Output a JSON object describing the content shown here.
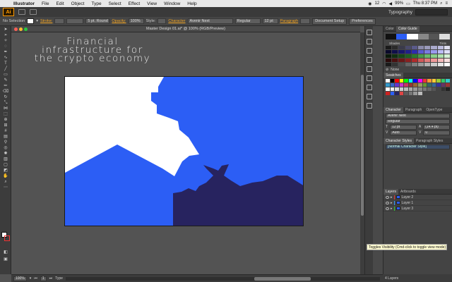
{
  "menubar": {
    "items": [
      "Illustrator",
      "File",
      "Edit",
      "Object",
      "Type",
      "Select",
      "Effect",
      "View",
      "Window",
      "Help"
    ],
    "status_count": "12",
    "battery": "99%",
    "clock": "Thu 8:37 PM"
  },
  "appbar": {
    "logo": "Ai",
    "workspace": "Typography"
  },
  "controlbar": {
    "selection": "No Selection",
    "stroke_label": "Stroke:",
    "brush": "5 pt. Round",
    "opacity_label": "Opacity:",
    "opacity_value": "100%",
    "style_label": "Style:",
    "character_label": "Character",
    "font_family": "Avenir Next",
    "font_style": "Regular",
    "font_size": "12 pt",
    "paragraph_label": "Paragraph",
    "doc_setup": "Document Setup",
    "preferences": "Preferences"
  },
  "document": {
    "tab_title": "Master Design 01.ai* @ 100% (RGB/Preview)"
  },
  "canvas": {
    "headline": [
      "Financial",
      "infrastructure for",
      "the crypto economy"
    ]
  },
  "colors": {
    "artboard_blue": "#2c5ef5",
    "dark_navy": "#27235f",
    "white": "#ffffff",
    "accent": "#f5a623"
  },
  "panels": {
    "color_tabs": [
      "Color",
      "Color Guide"
    ],
    "shades": "Shades",
    "tints": "Tints",
    "none_label": "None",
    "swatches_tab": "Swatches",
    "char_tabs": [
      "Character",
      "Paragraph",
      "OpenType"
    ],
    "char_font": "Avenir Next",
    "char_style": "Regular",
    "char_size": "12 pt",
    "char_leading": "(14.4 pt)",
    "char_kerning": "Auto",
    "char_tracking": "0",
    "style_tabs": [
      "Character Styles",
      "Paragraph Styles"
    ],
    "normal_style": "[Normal Character Style]",
    "layer_tabs": [
      "Layers",
      "Artboards"
    ],
    "layers": [
      "Layer 2",
      "Layer 1",
      "Layer 3"
    ],
    "layers_count": "4 Layers"
  },
  "tooltip": "Toggles Visibility (Cmd-click to toggle view mode)",
  "statusbar": {
    "zoom": "100%",
    "artboard_num": "1",
    "tool_label": "Type"
  }
}
